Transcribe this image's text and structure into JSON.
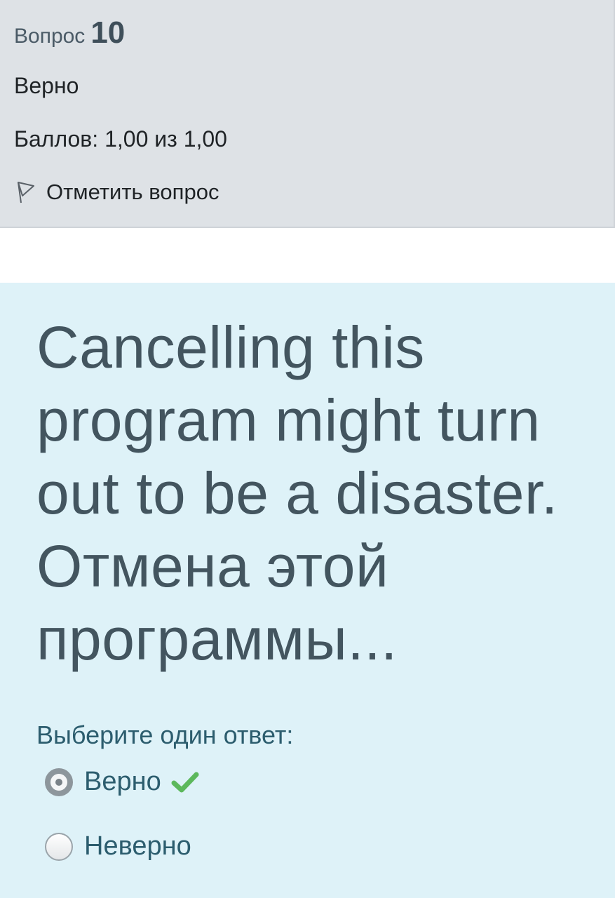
{
  "info": {
    "question_label": "Вопрос",
    "question_number": "10",
    "state": "Верно",
    "grade": "Баллов: 1,00 из 1,00",
    "flag_label": "Отметить вопрос",
    "flag_icon": "flag-icon"
  },
  "question": {
    "text": "Cancelling this program might turn out to be a disaster. Отмена этой программы...",
    "prompt": "Выберите один ответ:",
    "answers": [
      {
        "label": "Верно",
        "selected": true,
        "correct_icon": "check-icon"
      },
      {
        "label": "Неверно",
        "selected": false
      }
    ]
  },
  "colors": {
    "info_bg": "#dee2e6",
    "content_bg": "#def2f8",
    "check": "#5cb85c"
  }
}
